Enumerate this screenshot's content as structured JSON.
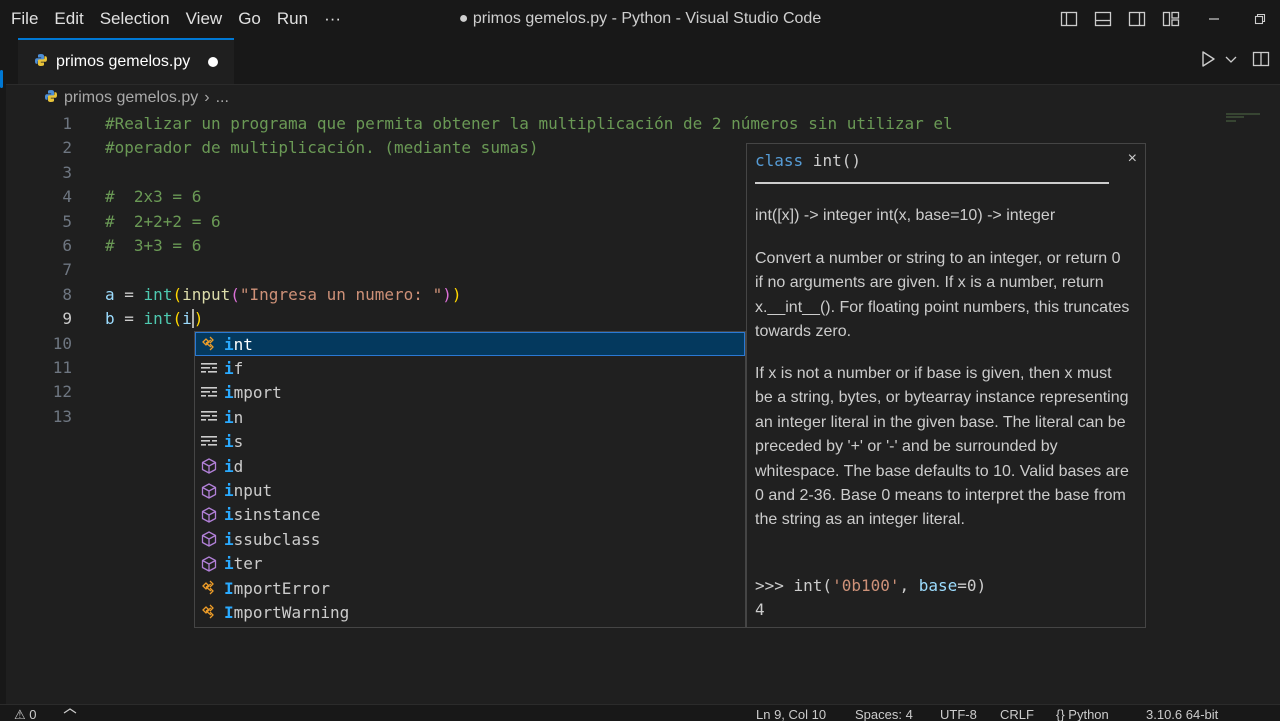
{
  "titlebar": {
    "menu": [
      "File",
      "Edit",
      "Selection",
      "View",
      "Go",
      "Run",
      "···"
    ],
    "title": "● primos gemelos.py - Python - Visual Studio Code",
    "tools": [
      "toggle-primary-sidebar-icon",
      "toggle-panel-icon",
      "toggle-secondary-sidebar-icon",
      "customize-layout-icon",
      "minimize-icon",
      "restore-icon"
    ]
  },
  "tab": {
    "label": "primos gemelos.py",
    "dirty": true
  },
  "tab_tools": [
    "run-python-file-icon",
    "chevron-down-icon",
    "more-actions-icon"
  ],
  "breadcrumb": {
    "file": "primos gemelos.py",
    "sep": "›",
    "tail": "..."
  },
  "editor": {
    "line_numbers": [
      "1",
      "2",
      "3",
      "4",
      "5",
      "6",
      "7",
      "8",
      "9",
      "10",
      "11",
      "12",
      "13"
    ],
    "lines": {
      "l1": "#Realizar un programa que permita obtener la multiplicación de 2 números sin utilizar el",
      "l2": "#operador de multiplicación. (mediante sumas)",
      "l4": "#  2x3 = 6",
      "l5": "#  2+2+2 = 6",
      "l6": "#  3+3 = 6",
      "l8": {
        "var": "a",
        "eq": " = ",
        "fn": "int",
        "p1": "(",
        "fn2": "input",
        "p2": "(",
        "str": "\"Ingresa un numero: \"",
        "p3": ")",
        "p4": ")"
      },
      "l9": {
        "var": "b",
        "eq": " = ",
        "fn": "int",
        "p1": "(",
        "typed": "i",
        "p2": ")"
      }
    }
  },
  "suggestions": [
    {
      "label": "int",
      "kind": "class",
      "rest": "nt"
    },
    {
      "label": "if",
      "kind": "keyword",
      "rest": "f"
    },
    {
      "label": "import",
      "kind": "keyword",
      "rest": "mport"
    },
    {
      "label": "in",
      "kind": "keyword",
      "rest": "n"
    },
    {
      "label": "is",
      "kind": "keyword",
      "rest": "s"
    },
    {
      "label": "id",
      "kind": "function",
      "rest": "d"
    },
    {
      "label": "input",
      "kind": "function",
      "rest": "nput"
    },
    {
      "label": "isinstance",
      "kind": "function",
      "rest": "sinstance"
    },
    {
      "label": "issubclass",
      "kind": "function",
      "rest": "ssubclass"
    },
    {
      "label": "iter",
      "kind": "function",
      "rest": "ter"
    },
    {
      "label": "ImportError",
      "kind": "class",
      "rest": "mportError"
    },
    {
      "label": "ImportWarning",
      "kind": "class",
      "rest": "mportWarning"
    }
  ],
  "docs": {
    "signature_kw": "class",
    "signature_rest": " int()",
    "close": "×",
    "p1": "int([x]) -> integer int(x, base=10) -> integer",
    "p2": "Convert a number or string to an integer, or return 0 if no arguments are given. If x is a number, return x.__int__(). For floating point numbers, this truncates towards zero.",
    "p3": "If x is not a number or if base is given, then x must be a string, bytes, or bytearray instance representing an integer literal in the given base. The literal can be preceded by '+' or '-' and be surrounded by whitespace. The base defaults to 10. Valid bases are 0 and 2-36. Base 0 means to interpret the base from the string as an integer literal.",
    "example": {
      "prompt": ">>> int(",
      "str": "'0b100'",
      "mid": ", ",
      "kw": "base",
      "end": "=0)"
    },
    "result": "4"
  },
  "statusbar": {
    "problems": "⚠ 0",
    "position": "Ln 9, Col 10",
    "spaces": "Spaces: 4",
    "encoding": "UTF-8",
    "eol": "CRLF",
    "language": "{} Python",
    "interpreter": "3.10.6 64-bit"
  },
  "colors": {
    "accent": "#0078d4",
    "selection": "#04395e",
    "comment": "#6a9955",
    "highlight": "#2aaaff"
  }
}
